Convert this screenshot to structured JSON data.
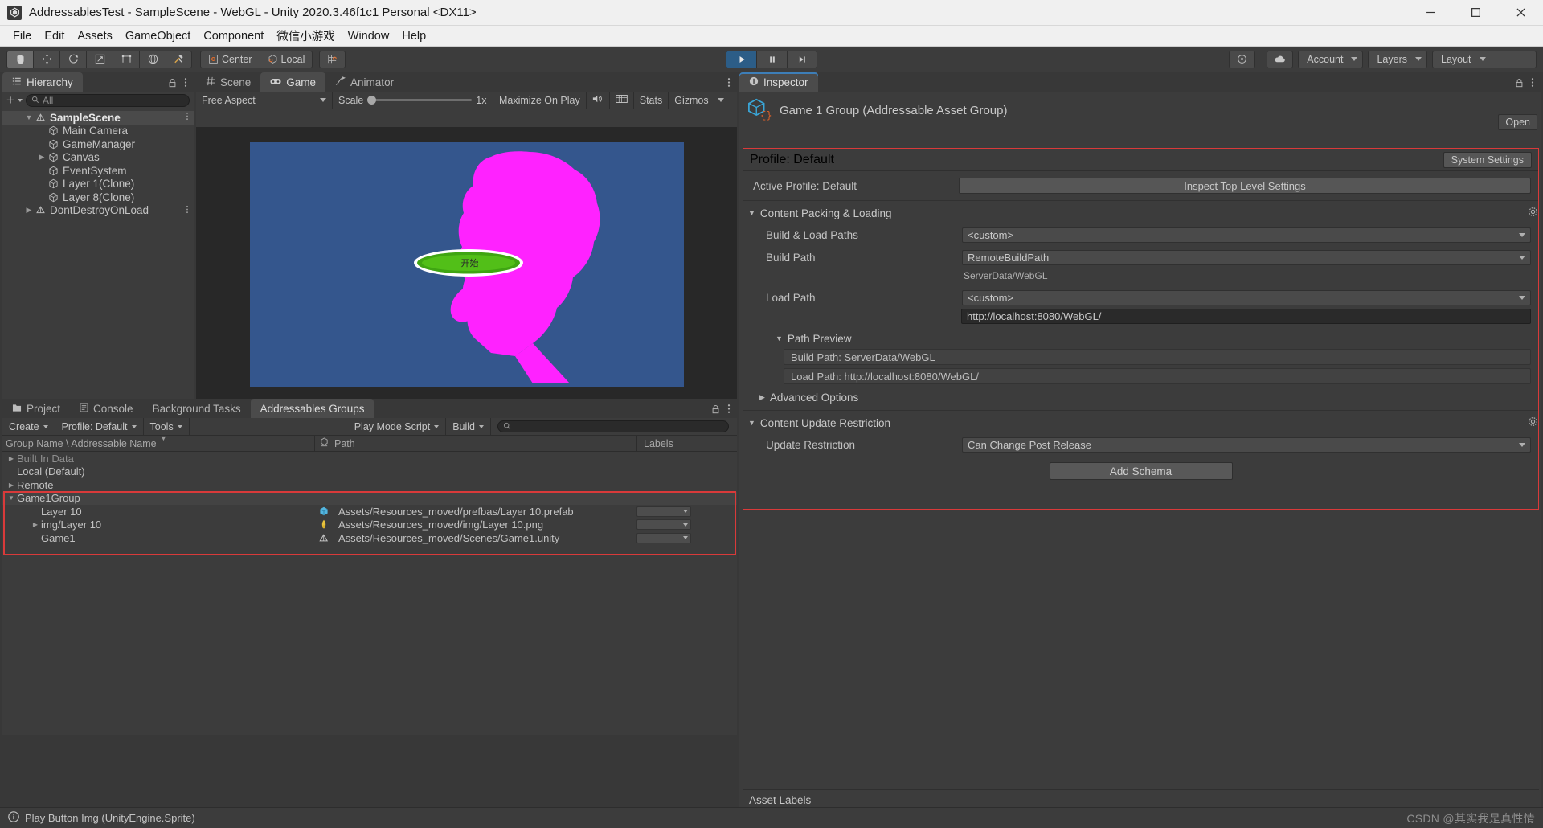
{
  "window": {
    "title": "AddressablesTest - SampleScene - WebGL - Unity 2020.3.46f1c1 Personal <DX11>",
    "minimize": "–",
    "maximize": "❐",
    "close": "✕"
  },
  "menubar": {
    "items": [
      "File",
      "Edit",
      "Assets",
      "GameObject",
      "Component",
      "微信小游戏",
      "Window",
      "Help"
    ]
  },
  "toolbar": {
    "pivot_center": "Center",
    "pivot_local": "Local",
    "account": "Account",
    "layers": "Layers",
    "layout": "Layout"
  },
  "hierarchy": {
    "tab": "Hierarchy",
    "search_placeholder": "All",
    "items": [
      {
        "label": "SampleScene",
        "depth": 0,
        "twist": "down",
        "icon": "scene-icon",
        "selected": true,
        "dots": true
      },
      {
        "label": "Main Camera",
        "depth": 1,
        "twist": "",
        "icon": "gameobject-icon",
        "selected": false,
        "dots": false
      },
      {
        "label": "GameManager",
        "depth": 1,
        "twist": "",
        "icon": "gameobject-icon",
        "selected": false,
        "dots": false
      },
      {
        "label": "Canvas",
        "depth": 1,
        "twist": "right",
        "icon": "gameobject-icon",
        "selected": false,
        "dots": false
      },
      {
        "label": "EventSystem",
        "depth": 1,
        "twist": "",
        "icon": "gameobject-icon",
        "selected": false,
        "dots": false
      },
      {
        "label": "Layer 1(Clone)",
        "depth": 1,
        "twist": "",
        "icon": "gameobject-icon",
        "selected": false,
        "dots": false
      },
      {
        "label": "Layer 8(Clone)",
        "depth": 1,
        "twist": "",
        "icon": "gameobject-icon",
        "selected": false,
        "dots": false
      },
      {
        "label": "DontDestroyOnLoad",
        "depth": 0,
        "twist": "right",
        "icon": "scene-icon",
        "selected": false,
        "dots": true
      }
    ]
  },
  "viewpanel": {
    "tabs": [
      {
        "label": "Scene",
        "icon": "grid-icon",
        "active": false
      },
      {
        "label": "Game",
        "icon": "gamepad-icon",
        "active": true
      },
      {
        "label": "Animator",
        "icon": "animator-icon",
        "active": false
      }
    ],
    "aspect": "Free Aspect",
    "scale_label": "Scale",
    "scale_value": "1x",
    "maximize_on_play": "Maximize On Play",
    "stats": "Stats",
    "gizmos": "Gizmos"
  },
  "inspector": {
    "tab": "Inspector",
    "open_button": "Open",
    "object_title": "Game 1 Group (Addressable Asset Group)",
    "profile_line": "Profile: Default",
    "system_settings": "System Settings",
    "active_profile": "Active Profile: Default",
    "inspect_top_level": "Inspect Top Level Settings",
    "content_packing": "Content Packing & Loading",
    "build_load_paths_label": "Build & Load Paths",
    "build_load_paths_value": "<custom>",
    "build_path_label": "Build Path",
    "build_path_value": "RemoteBuildPath",
    "build_path_sub": "ServerData/WebGL",
    "load_path_label": "Load Path",
    "load_path_value": "<custom>",
    "load_path_sub": "http://localhost:8080/WebGL/",
    "path_preview": "Path Preview",
    "preview_build": "Build Path: ServerData/WebGL",
    "preview_load": "Load Path: http://localhost:8080/WebGL/",
    "advanced_options": "Advanced Options",
    "content_update_restriction": "Content Update Restriction",
    "update_restriction_label": "Update Restriction",
    "update_restriction_value": "Can Change Post Release",
    "add_schema": "Add Schema",
    "asset_labels": "Asset Labels"
  },
  "bottom": {
    "tabs": [
      {
        "label": "Project",
        "icon": "folder-icon",
        "active": false
      },
      {
        "label": "Console",
        "icon": "console-icon",
        "active": false
      },
      {
        "label": "Background Tasks",
        "icon": "",
        "active": false
      },
      {
        "label": "Addressables Groups",
        "icon": "",
        "active": true
      }
    ],
    "create": "Create",
    "profile": "Profile: Default",
    "tools": "Tools",
    "play_mode_script": "Play Mode Script",
    "build": "Build",
    "search_placeholder": "",
    "columns": {
      "name": "Group Name \\ Addressable Name",
      "path": "Path",
      "labels": "Labels"
    },
    "rows": [
      {
        "name": "Built In Data",
        "twist": "right",
        "indent": 0,
        "path": "",
        "icon": "",
        "kind": "group",
        "selected": false,
        "dim": true
      },
      {
        "name": "Local (Default)",
        "twist": "",
        "indent": 0,
        "path": "",
        "icon": "",
        "kind": "group",
        "selected": false,
        "dim": false
      },
      {
        "name": "Remote",
        "twist": "right",
        "indent": 0,
        "path": "",
        "icon": "",
        "kind": "group",
        "selected": false,
        "dim": false
      },
      {
        "name": "Game1Group",
        "twist": "down",
        "indent": 0,
        "path": "",
        "icon": "",
        "kind": "group",
        "selected": true,
        "dim": false
      },
      {
        "name": "Layer 10",
        "twist": "",
        "indent": 1,
        "path": "Assets/Resources_moved/prefbas/Layer 10.prefab",
        "icon": "prefab-icon",
        "kind": "entry",
        "selected": false,
        "dim": false
      },
      {
        "name": "img/Layer 10",
        "twist": "right",
        "indent": 1,
        "path": "Assets/Resources_moved/img/Layer 10.png",
        "icon": "sprite-icon",
        "kind": "entry",
        "selected": false,
        "dim": false
      },
      {
        "name": "Game1",
        "twist": "",
        "indent": 1,
        "path": "Assets/Resources_moved/Scenes/Game1.unity",
        "icon": "scene-asset-icon",
        "kind": "entry",
        "selected": false,
        "dim": false
      }
    ]
  },
  "status": {
    "message": "Play Button Img (UnityEngine.Sprite)",
    "watermark": "CSDN @其实我是真性情"
  },
  "colors": {
    "accent_red": "#d93a3a",
    "tab_active": "#4b4b4b",
    "panel": "#3c3c3c",
    "game_bg": "#34568d",
    "sprite_magenta": "#ff22ff",
    "platform_green": "#4caf22"
  }
}
